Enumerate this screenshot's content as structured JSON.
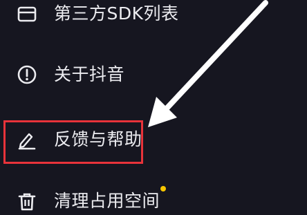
{
  "menu": {
    "items": [
      {
        "label": "第三方SDK列表",
        "icon": "card-icon"
      },
      {
        "label": "关于抖音",
        "icon": "info-circle-icon"
      },
      {
        "label": "反馈与帮助",
        "icon": "pencil-icon",
        "highlighted": true
      },
      {
        "label": "清理占用空间",
        "icon": "trash-icon",
        "badge": "dot"
      }
    ]
  },
  "colors": {
    "background": "#161620",
    "text": "#ececf0",
    "highlight_border": "#e8333a",
    "notification_dot": "#f7c600",
    "arrow": "#ffffff"
  }
}
